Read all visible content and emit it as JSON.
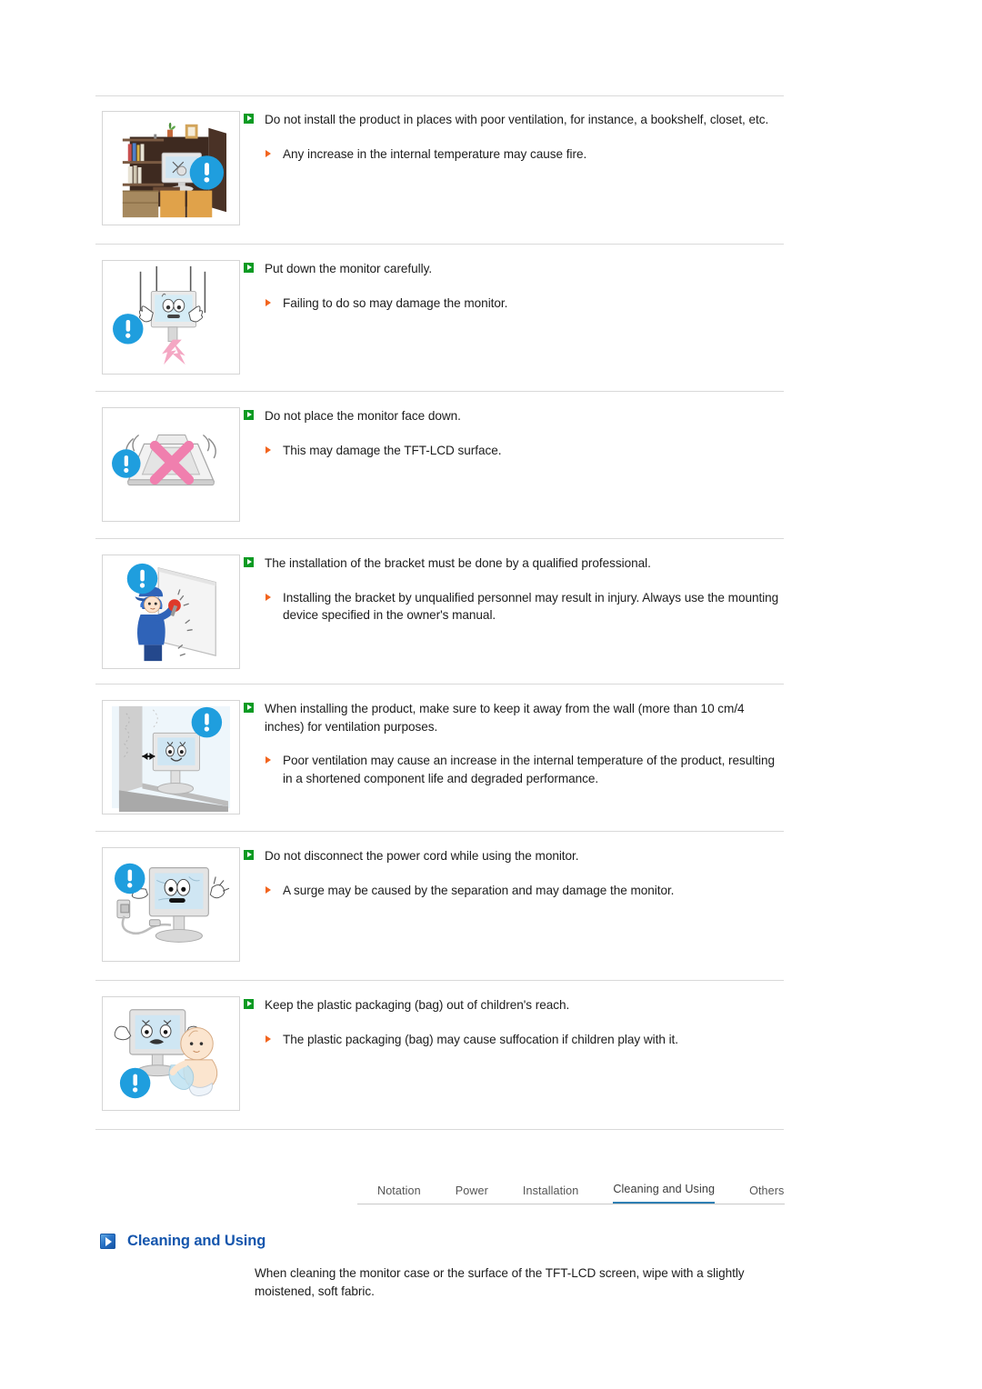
{
  "theme": {
    "accent_blue": "#1556ad",
    "tab_active_underline": "#2e7fb3",
    "bullet_green": "#0a9a22",
    "bullet_orange": "#f2641e",
    "divider": "#d9d9d9"
  },
  "sections": [
    {
      "icon_name": "bookshelf-monitor-warning-illustration",
      "main": "Do not install the product in places with poor ventilation, for instance, a bookshelf, closet, etc.",
      "sub": "Any increase in the internal temperature may cause fire."
    },
    {
      "icon_name": "dropping-monitor-warning-illustration",
      "main": "Put down the monitor carefully.",
      "sub": "Failing to do so may damage the monitor."
    },
    {
      "icon_name": "monitor-face-down-warning-illustration",
      "main": "Do not place the monitor face down.",
      "sub": "This may damage the TFT-LCD surface."
    },
    {
      "icon_name": "bracket-installation-professional-illustration",
      "main": "The installation of the bracket must be done by a qualified professional.",
      "sub": "Installing the bracket by unqualified personnel may result in injury. Always use the mounting device specified in the owner's manual."
    },
    {
      "icon_name": "wall-clearance-ventilation-illustration",
      "main": "When installing the product, make sure to keep it away from the wall (more than 10 cm/4 inches) for ventilation purposes.",
      "sub": "Poor ventilation may cause an increase in the internal temperature of the product, resulting in a shortened component life and degraded performance."
    },
    {
      "icon_name": "power-cord-disconnect-warning-illustration",
      "main": "Do not disconnect the power cord while using the monitor.",
      "sub": "A surge may be caused by the separation and may damage the monitor."
    },
    {
      "icon_name": "plastic-bag-child-warning-illustration",
      "main": "Keep the plastic packaging (bag) out of children's reach.",
      "sub": "The plastic packaging (bag) may cause suffocation if children play with it."
    }
  ],
  "tabs": [
    {
      "label": "Notation",
      "active": false
    },
    {
      "label": "Power",
      "active": false
    },
    {
      "label": "Installation",
      "active": false
    },
    {
      "label": "Cleaning and Using",
      "active": true
    },
    {
      "label": "Others",
      "active": false
    }
  ],
  "heading": {
    "icon_name": "blue-arrow-heading-icon",
    "title": "Cleaning and Using"
  },
  "closing_paragraph": "When cleaning the monitor case or the surface of the TFT-LCD screen, wipe with a slightly moistened, soft fabric."
}
